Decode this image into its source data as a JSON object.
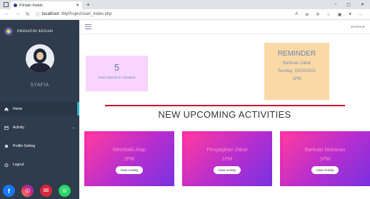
{
  "browser": {
    "tab_title": "Prihatin Kedah",
    "new_tab": "+",
    "url_host": "localhost",
    "url_path": "/MyProject/user_index.php",
    "window_controls": [
      "–",
      "▢",
      "✕"
    ]
  },
  "sidebar": {
    "brand": "PRIHATIN KEDAH",
    "username": "SYAFIA",
    "items": [
      {
        "label": "Home"
      },
      {
        "label": "Activity"
      },
      {
        "label": "Profile Setting"
      },
      {
        "label": "Logout"
      }
    ],
    "socials": [
      "f",
      "◎",
      "✉",
      "☏"
    ]
  },
  "topbar": {
    "user_menu": "SYAFIA ▾"
  },
  "stats": {
    "hours_value": "5",
    "hours_label": "Hours Spend on Volunteer"
  },
  "reminder": {
    "title": "REMINDER",
    "event": "Bantuan Zakat",
    "date": "Sunday, 15/04/2022",
    "time": "1PM"
  },
  "section_heading": "NEW UPCOMING ACTIVITIES",
  "activities": [
    {
      "name": "Membaiki Atap",
      "time": "2PM",
      "button": "View Activity"
    },
    {
      "name": "Pengagihan Zakat",
      "time": "1PM",
      "button": "View Activity"
    },
    {
      "name": "Bantuan Makanan",
      "time": "1PM",
      "button": "View Activity"
    }
  ],
  "colors": {
    "sidebar": "#2e3c4d",
    "accent": "#27b3c9",
    "divider": "#c8102e",
    "reminder_bg": "#fbd9a6",
    "hours_bg": "#f8d4ff"
  }
}
